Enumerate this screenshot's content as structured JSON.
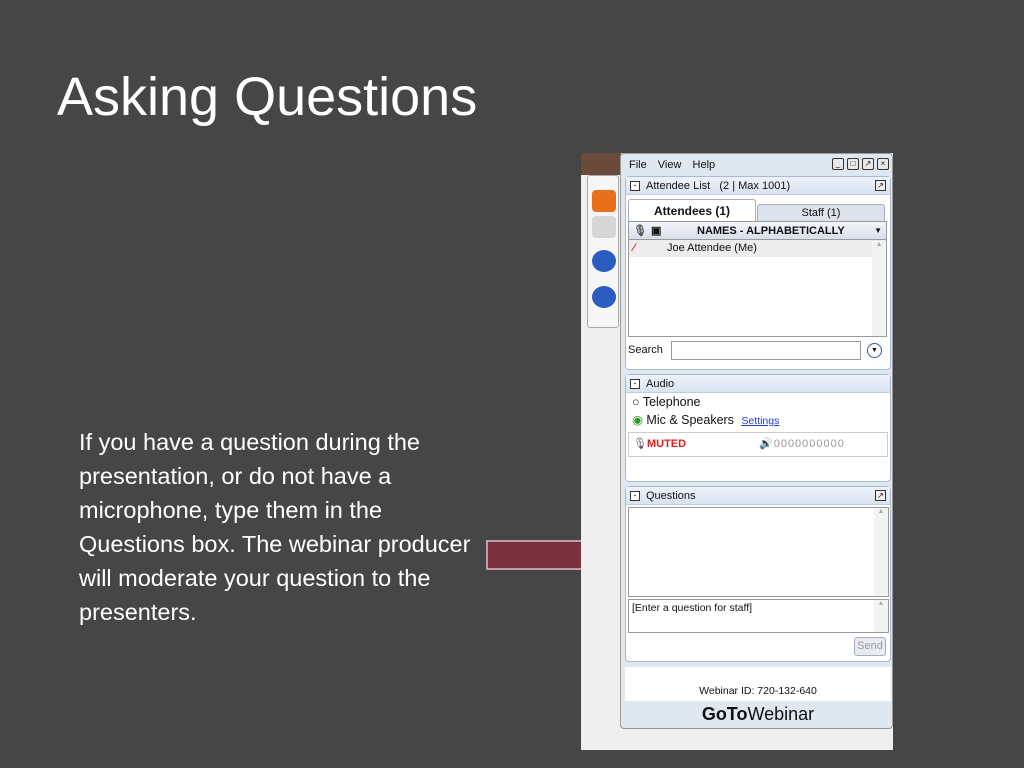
{
  "slide": {
    "title": "Asking Questions",
    "body": "If you have a question during the presentation, or do not have a microphone, type them in the Questions box. The webinar producer will moderate your question to the presenters."
  },
  "app": {
    "menu": [
      "File",
      "View",
      "Help"
    ],
    "attendee_list": {
      "title": "Attendee List",
      "count": "(2 | Max 1001)",
      "tabs": [
        "Attendees (1)",
        "Staff (1)"
      ],
      "column": "NAMES - ALPHABETICALLY",
      "rows": [
        "Joe Attendee (Me)"
      ],
      "search_label": "Search",
      "search_value": ""
    },
    "audio": {
      "title": "Audio",
      "options": [
        "Telephone",
        "Mic & Speakers"
      ],
      "selected": "Mic & Speakers",
      "settings_link": "Settings",
      "status": "MUTED",
      "level": "0000000000",
      "status_color": "#e02020"
    },
    "questions": {
      "title": "Questions",
      "placeholder": "[Enter a question for staff]",
      "send_label": "Send"
    },
    "webinar_id": "Webinar ID: 720-132-640",
    "brand_bold": "GoTo",
    "brand_rest": "Webinar"
  },
  "colors": {
    "background": "#464646",
    "arrow": "#7b3040"
  }
}
